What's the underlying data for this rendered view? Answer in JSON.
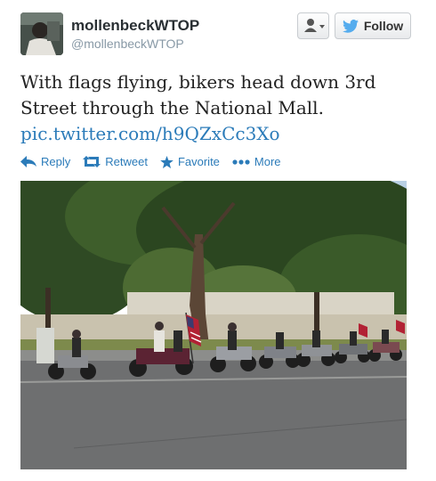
{
  "author": {
    "name": "mollenbeckWTOP",
    "handle": "@mollenbeckWTOP"
  },
  "buttons": {
    "follow_label": "Follow"
  },
  "tweet": {
    "text_line1": "With flags flying, bikers head down 3rd",
    "text_line2": "Street through the National Mall.",
    "link": "pic.twitter.com/h9QZxCc3Xo"
  },
  "actions": [
    {
      "label": "Reply",
      "icon": "reply-icon"
    },
    {
      "label": "Retweet",
      "icon": "retweet-icon"
    },
    {
      "label": "Favorite",
      "icon": "star-icon"
    },
    {
      "label": "More",
      "icon": "more-icon"
    }
  ],
  "colors": {
    "link": "#2b7bb9",
    "text": "#222222",
    "muted": "#8899a6",
    "twitter_blue": "#55acee"
  }
}
